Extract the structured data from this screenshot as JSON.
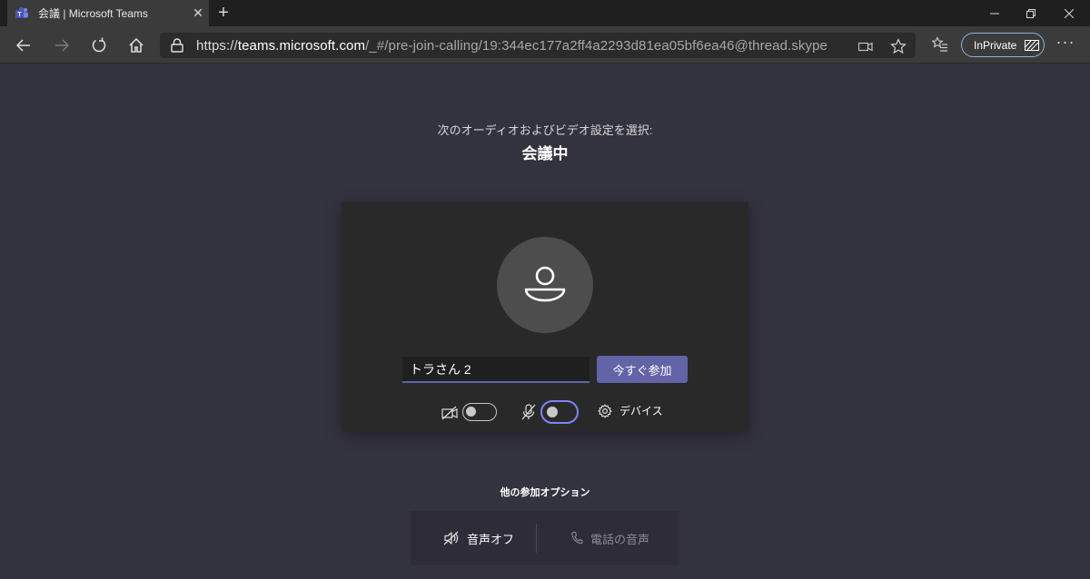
{
  "browser": {
    "tab_title": "会議 | Microsoft Teams",
    "tab_close": "✕",
    "new_tab": "+",
    "url_scheme": "https://",
    "url_host": "teams.microsoft.com",
    "url_path": "/_#/pre-join-calling/19:344ec177a2ff4a2293d81ea05bf6ea46@thread.skype",
    "inprivate_label": "InPrivate",
    "more_label": "···"
  },
  "prejoin": {
    "subtitle": "次のオーディオおよびビデオ設定を選択:",
    "title": "会議中",
    "name_value": "トラさん 2",
    "join_label": "今すぐ参加",
    "devices_label": "デバイス",
    "camera_on": false,
    "mic_on": false
  },
  "other_options": {
    "title": "他の参加オプション",
    "audio_off_label": "音声オフ",
    "phone_audio_label": "電話の音声"
  },
  "colors": {
    "page_bg": "#33323f",
    "card_bg": "#292929",
    "accent": "#6264a7",
    "toggle_focus": "#7f85f5"
  }
}
